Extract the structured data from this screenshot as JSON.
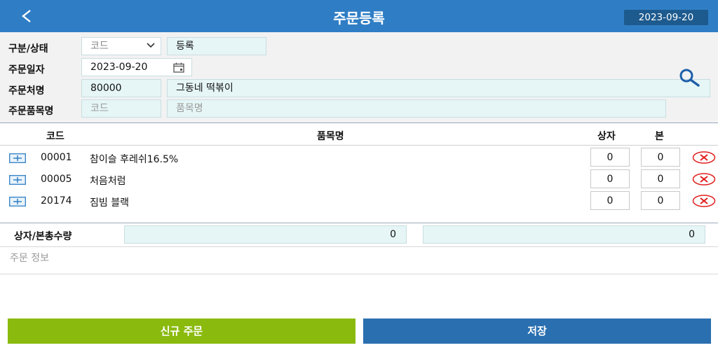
{
  "header": {
    "back_symbol": "<",
    "title": "주문등록",
    "date": "2023-09-20"
  },
  "form": {
    "type_label": "구분/상태",
    "type_select_value": "코드",
    "status_value": "등록",
    "order_date_label": "주문일자",
    "order_date_value": "2023-09-20",
    "customer_label": "주문처명",
    "customer_code": "80000",
    "customer_name": "그동네 떡볶이",
    "item_label": "주문품목명",
    "item_code_placeholder": "코드",
    "item_name_placeholder": "품목명"
  },
  "table": {
    "headers": {
      "code": "코드",
      "name": "품목명",
      "box": "상자",
      "bottle": "본"
    },
    "rows": [
      {
        "code": "00001",
        "name": "참이슬 후레쉬16.5%",
        "box": "0",
        "bottle": "0"
      },
      {
        "code": "00005",
        "name": "처음처럼",
        "box": "0",
        "bottle": "0"
      },
      {
        "code": "20174",
        "name": "짐빔 블랙",
        "box": "0",
        "bottle": "0"
      }
    ]
  },
  "totals": {
    "label": "상자/본총수량",
    "box_total": "0",
    "bottle_total": "0"
  },
  "memo": {
    "placeholder": "주문 정보"
  },
  "buttons": {
    "new_order": "신규 주문",
    "save": "저장"
  },
  "colors": {
    "header_bg": "#2f7ec5",
    "new_order_btn": "#8aba0e",
    "save_btn": "#2a6fb0",
    "delete_icon": "#e02020"
  },
  "icons": [
    "back-icon",
    "select-chevron-icon",
    "calendar-icon",
    "search-icon",
    "expand-plus-icon",
    "delete-x-icon"
  ]
}
